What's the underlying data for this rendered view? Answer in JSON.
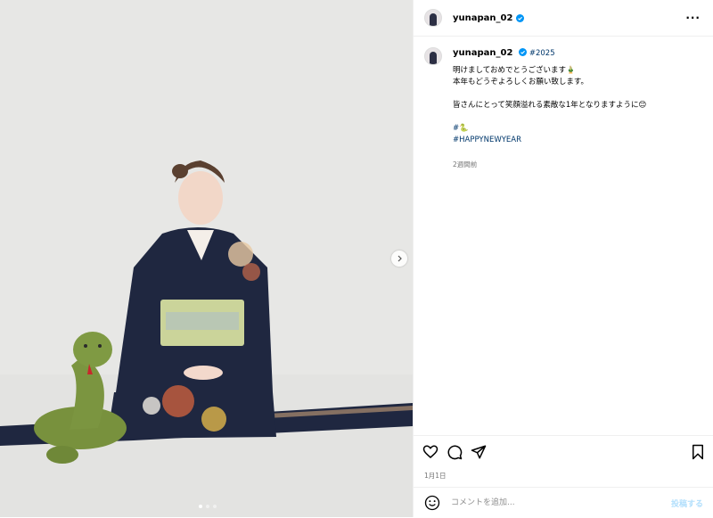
{
  "media": {
    "carousel": {
      "slide_count": 3,
      "active_index": 0
    }
  },
  "header": {
    "username": "yunapan_02"
  },
  "caption": {
    "username": "yunapan_02",
    "hashtag_inline": "#2025",
    "line1": "明けましておめでとうございます🎍",
    "line2": "本年もどうぞよろしくお願い致します。",
    "line3": "皆さんにとって笑顔溢れる素敵な1年となりますように😊",
    "tag1": "#🐍",
    "tag2": "#HAPPYNEWYEAR",
    "time_ago": "2週間前"
  },
  "footer": {
    "date": "1月1日",
    "comment_placeholder": "コメントを追加...",
    "post_label": "投稿する"
  },
  "icons": {
    "more": "more-icon",
    "like": "heart-icon",
    "comment": "comment-icon",
    "share": "share-icon",
    "save": "bookmark-icon",
    "emoji": "emoji-icon",
    "next": "chevron-right-icon"
  },
  "colors": {
    "verified": "#0095f6",
    "link": "#00376b",
    "meta": "#737373",
    "post_disabled": "#b2dffc"
  }
}
